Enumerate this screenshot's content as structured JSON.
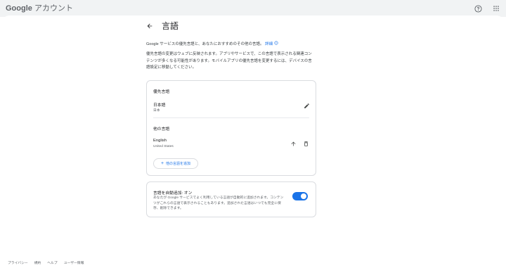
{
  "app": {
    "brand_google": "Google",
    "brand_suffix": "アカウント"
  },
  "page": {
    "title": "言語"
  },
  "intro": {
    "text": "Google サービスの優先言語と、あなたにおすすめのその他の言語。",
    "link": "詳細",
    "text2": "優先言語の変更はウェブに反映されます。アプリやサービスで、この言語で表示される関連コンテンツが多くなる可能性があります。モバイルアプリの優先言語を変更するには、デバイスの言語設定に移動してください。"
  },
  "preferred": {
    "section_title": "優先言語",
    "language": "日本語",
    "language_sub": "日本"
  },
  "others": {
    "section_title": "他の言語",
    "language": "English",
    "language_sub": "United States",
    "add_button": "他の言語を追加"
  },
  "auto_add": {
    "title": "言語を自動追加: オン",
    "description": "あなたが Google サービスでよく利用している言語が自動的に追加されます。コンテンツがこれらの言語で表示されることもあります。追加された言語はいつでも完全に保存、削除できます。",
    "enabled": true
  },
  "footer": {
    "links": [
      "プライバシー",
      "規約",
      "ヘルプ",
      "ユーザー情報"
    ]
  },
  "colors": {
    "accent": "#1a73e8",
    "topbar": "#f1f3f4",
    "border": "#dadce0"
  }
}
